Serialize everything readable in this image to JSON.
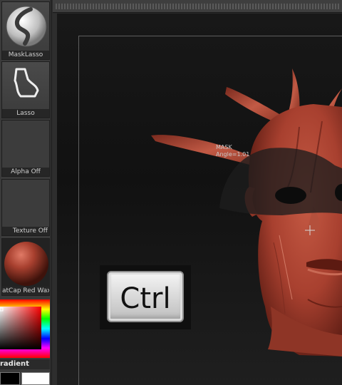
{
  "shelf": {
    "mask_lasso_label": "MaskLasso",
    "lasso_label": "Lasso",
    "alpha_label": "Alpha  Off",
    "texture_label": "Texture  Off",
    "matcap_label": "atCap  Red  Wax",
    "gradient_label": "radient"
  },
  "canvas": {
    "mask_readout_line1": "MASK",
    "mask_readout_line2": "Angle=1.01"
  },
  "keycap": {
    "label": "Ctrl"
  },
  "colors": {
    "clay": "#a8402f",
    "mask_overlay": "#1e1e1e",
    "background": "#141414"
  }
}
